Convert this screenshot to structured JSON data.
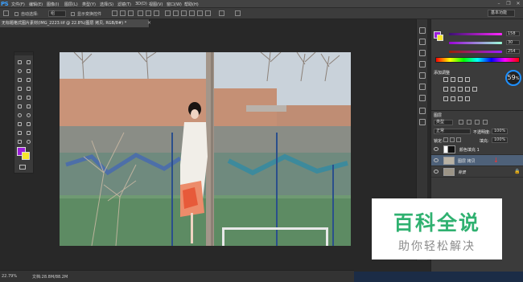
{
  "app": {
    "logo": "PS"
  },
  "menubar": {
    "items": [
      "文件(F)",
      "编辑(E)",
      "图像(I)",
      "图层(L)",
      "类型(Y)",
      "选择(S)",
      "滤镜(T)",
      "3D(D)",
      "视图(V)",
      "窗口(W)",
      "帮助(H)"
    ],
    "window_controls": [
      "–",
      "❐",
      "✕"
    ]
  },
  "options_bar": {
    "auto_select_label": "自动选择:",
    "auto_select_value": "组",
    "show_transform_label": "显示变换控件",
    "workspace": "基本功能"
  },
  "document_tab": {
    "title": "无标题格式图片素材(IMG_2223.tif @ 22.8%(图层 拷贝, RGB/8#) *",
    "close": "×"
  },
  "status_bar": {
    "zoom": "22.79%",
    "doc_info": "文档:28.8M/88.2M"
  },
  "color_panel": {
    "r_value": "158",
    "g_value": "30",
    "b_value": "254"
  },
  "adjustments_panel": {
    "title": "添加调整",
    "ring_value": "59",
    "ring_unit": "%"
  },
  "layers_panel": {
    "tab_label": "图层",
    "filter_label": "类型",
    "blend_mode": "正常",
    "opacity_label": "不透明度:",
    "opacity_value": "100%",
    "lock_label": "锁定:",
    "fill_label": "填充:",
    "fill_value": "100%",
    "layers": [
      {
        "name": "颜色填充 1",
        "active": false
      },
      {
        "name": "图层 拷贝",
        "active": true
      },
      {
        "name": "背景",
        "active": false
      }
    ]
  },
  "watermark": {
    "title": "百科全说",
    "subtitle": "助你轻松解决"
  }
}
